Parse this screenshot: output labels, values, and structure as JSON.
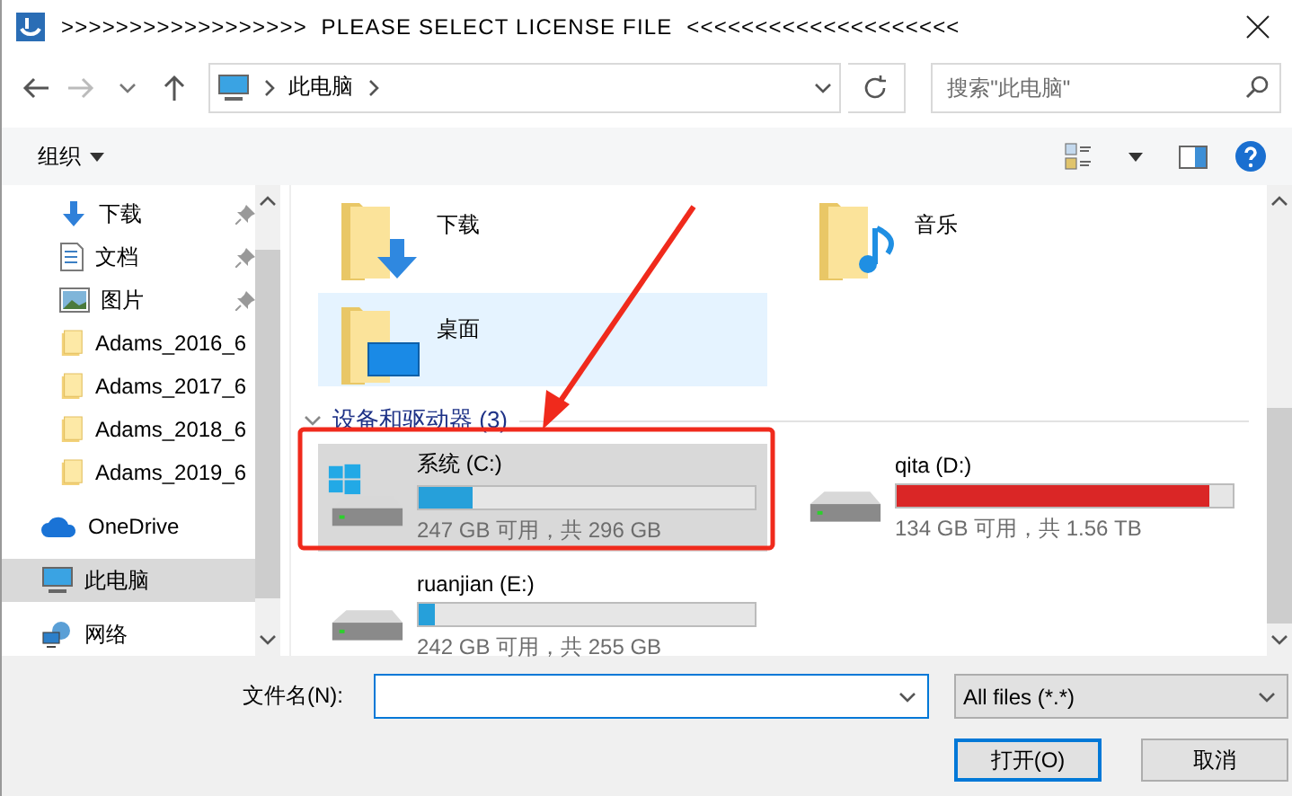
{
  "window": {
    "title": ">>>>>>>>>>>>>>>>>>  PLEASE SELECT LICENSE FILE  <<<<<<<<<<<<<<<<<<<<"
  },
  "address": {
    "path": [
      "此电脑"
    ]
  },
  "search": {
    "placeholder": "搜索\"此电脑\""
  },
  "toolbar": {
    "organize": "组织"
  },
  "sidebar": {
    "items": [
      {
        "label": "下载",
        "kind": "download",
        "pinned": true,
        "selected": false
      },
      {
        "label": "文档",
        "kind": "document",
        "pinned": true,
        "selected": false
      },
      {
        "label": "图片",
        "kind": "picture",
        "pinned": true,
        "selected": false
      },
      {
        "label": "Adams_2016_6",
        "kind": "folder",
        "pinned": false,
        "selected": false
      },
      {
        "label": "Adams_2017_6",
        "kind": "folder",
        "pinned": false,
        "selected": false
      },
      {
        "label": "Adams_2018_6",
        "kind": "folder",
        "pinned": false,
        "selected": false
      },
      {
        "label": "Adams_2019_6",
        "kind": "folder",
        "pinned": false,
        "selected": false
      },
      {
        "label": "OneDrive",
        "kind": "cloud",
        "pinned": false,
        "selected": false
      },
      {
        "label": "此电脑",
        "kind": "computer",
        "pinned": false,
        "selected": true
      },
      {
        "label": "网络",
        "kind": "network",
        "pinned": false,
        "selected": false
      }
    ]
  },
  "folders": [
    {
      "label": "下载",
      "kind": "download",
      "selected": false
    },
    {
      "label": "音乐",
      "kind": "music",
      "selected": false
    },
    {
      "label": "桌面",
      "kind": "desktop",
      "selected": true
    }
  ],
  "drives_section": {
    "title": "设备和驱动器 (3)",
    "expanded": true
  },
  "drives": [
    {
      "name": "系统 (C:)",
      "kind": "system",
      "level": 0.16,
      "free": "247 GB 可用，共 296 GB",
      "color": "#26a0da",
      "selected": true
    },
    {
      "name": "qita (D:)",
      "kind": "disk",
      "level": 0.93,
      "free": "134 GB 可用，共 1.56 TB",
      "color": "#da2626",
      "selected": false
    },
    {
      "name": "ruanjian (E:)",
      "kind": "disk",
      "level": 0.05,
      "free": "242 GB 可用，共 255 GB",
      "color": "#26a0da",
      "selected": false
    }
  ],
  "footer": {
    "filename_label": "文件名(N):",
    "filter": "All files (*.*)",
    "buttons": [
      {
        "label": "打开(O)",
        "default": true
      },
      {
        "label": "取消",
        "default": false
      }
    ]
  }
}
